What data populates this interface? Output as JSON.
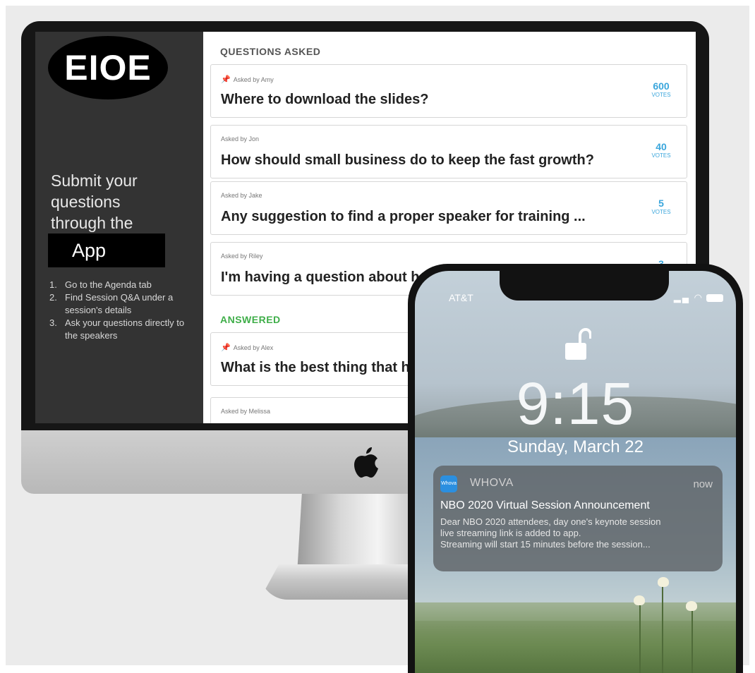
{
  "colors": {
    "sidebar_bg": "#333333",
    "answered_green": "#3fae49",
    "vote_blue": "#3aa6dc",
    "whova_blue": "#2b8fe0"
  },
  "sidebar": {
    "logo_text": "EIOE",
    "submit_lines": [
      "Submit your",
      "questions",
      "through the"
    ],
    "app_label": "App",
    "steps": [
      {
        "num": "1.",
        "text": "Go to the Agenda tab"
      },
      {
        "num": "2.",
        "text": "Find Session Q&A under a session's details"
      },
      {
        "num": "3.",
        "text": "Ask your questions directly to the speakers"
      }
    ]
  },
  "questions_section": {
    "title": "QUESTIONS ASKED",
    "items": [
      {
        "asked_by": "Asked by Amy",
        "pinned": true,
        "question": "Where to download the slides?",
        "votes": "600",
        "votes_label": "VOTES"
      },
      {
        "asked_by": "Asked by Jon",
        "pinned": false,
        "question": "How should small business do to keep the fast growth?",
        "votes": "40",
        "votes_label": "VOTES"
      },
      {
        "asked_by": "Asked by Jake",
        "pinned": false,
        "question": "Any suggestion to find a proper speaker for training ...",
        "votes": "5",
        "votes_label": "VOTES"
      },
      {
        "asked_by": "Asked by Riley",
        "pinned": false,
        "question": "I'm having a question about h",
        "votes": "3",
        "votes_label": ""
      }
    ]
  },
  "answered_section": {
    "title": "ANSWERED",
    "items": [
      {
        "asked_by": "Asked by Alex",
        "pinned": true,
        "question": "What is the best thing that h"
      },
      {
        "asked_by": "Asked by Melissa",
        "pinned": false,
        "question": ""
      }
    ]
  },
  "phone": {
    "carrier": "AT&T",
    "time": "9:15",
    "date": "Sunday, March 22",
    "notification": {
      "app_icon_text": "Whova",
      "app": "WHOVA",
      "time": "now",
      "title": "NBO 2020 Virtual Session Announcement",
      "body_lines": [
        "Dear NBO 2020 attendees, day one's keynote session",
        "live streaming link is added to app.",
        "Streaming will start 15 minutes before the session..."
      ]
    }
  }
}
